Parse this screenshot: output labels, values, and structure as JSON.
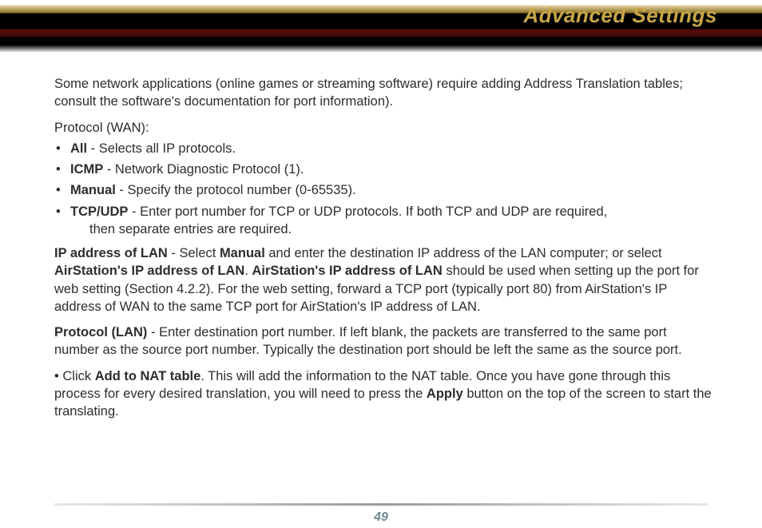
{
  "header": {
    "title": "Advanced Settings"
  },
  "content": {
    "intro": "Some network applications (online games or streaming software) require adding Address Translation tables; consult the software's documentation for port information).",
    "proto_label": "Protocol (WAN):",
    "items": {
      "all": {
        "term": "All",
        "desc": " - Selects all IP protocols."
      },
      "icmp": {
        "term": "ICMP",
        "desc": " - Network Diagnostic Protocol (1)."
      },
      "manual": {
        "term": "Manual",
        "desc": " - Specify the protocol number (0-65535)."
      },
      "tcpudp": {
        "term": "TCP/UDP",
        "desc_line1": " - Enter port number for TCP or UDP protocols.  If both TCP and UDP are required,",
        "desc_line2": "then separate entries are required."
      }
    },
    "ip_lan": {
      "lead": "IP address of LAN",
      "t1": " - Select ",
      "manual": "Manual",
      "t2": " and enter the destination IP address of the LAN computer; or select ",
      "air1": "AirStation's IP address of LAN",
      "t3": ".  ",
      "air2": "AirStation's IP address of LAN",
      "t4": " should be used when setting up the port for web setting (Section 4.2.2).  For the web setting, forward a TCP port (typically port 80) from AirStation's IP address of WAN to the same TCP port for AirStation's IP address of LAN."
    },
    "proto_lan": {
      "lead": "Protocol (LAN)",
      "rest": " - Enter destination port number.  If left blank, the packets are transferred to the same port number as the source port number.  Typically the destination port should be left the same as the source port."
    },
    "nat": {
      "bullet": "• Click ",
      "add": "Add to NAT table",
      "mid": ".  This will add the information to the NAT table.  Once you have gone through this process for every desired translation, you will need to press the ",
      "apply": "Apply",
      "end": " button on the top of the screen to start the translating."
    }
  },
  "footer": {
    "page": "49"
  }
}
